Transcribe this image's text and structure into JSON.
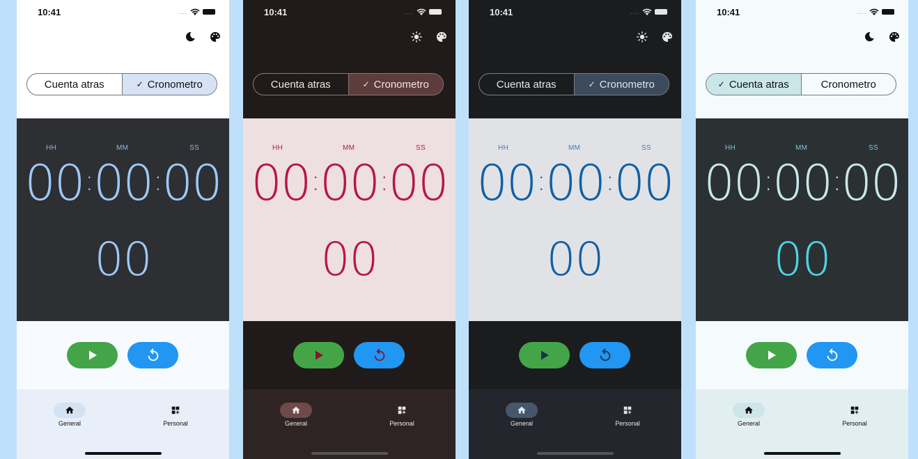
{
  "status": {
    "time": "10:41",
    "dots": "...."
  },
  "segments": {
    "countdown": "Cuenta atras",
    "stopwatch": "Cronometro",
    "check": "✓"
  },
  "timer": {
    "hh_label": "HH",
    "mm_label": "MM",
    "ss_label": "SS",
    "hours": "00",
    "minutes": "00",
    "seconds": "00",
    "separator": ":",
    "centiseconds": "00"
  },
  "nav": {
    "general": "General",
    "personal": "Personal"
  },
  "icons": {
    "moon": "moon-icon",
    "sun": "sun-icon",
    "palette": "palette-icon",
    "play": "play-icon",
    "reset": "reset-icon",
    "home": "home-icon",
    "grid_add": "grid-add-icon"
  },
  "variants": [
    {
      "theme_toggle_icon": "moon-icon",
      "selected_segment": "Cronometro",
      "colors": {
        "bg": "#ffffff",
        "text": "#111111",
        "panel": "#2d2f33",
        "digit": "#9ec9f7",
        "centis": "#9ec9f7",
        "unit": "#8fb6e6",
        "seg_selected": "#d8e2f5",
        "seg_border": "#6f7580",
        "controls_bg": "#f7fafe",
        "nav_bg": "#e8eff8",
        "pill": "#d3e3f4",
        "play_icon": "#ffffff",
        "reset_icon": "#ffffff",
        "homebar": "#111111"
      }
    },
    {
      "theme_toggle_icon": "sun-icon",
      "selected_segment": "Cronometro",
      "colors": {
        "bg": "#201a1a",
        "text": "#f1e6e5",
        "panel": "#eee0e0",
        "digit": "#b8144f",
        "centis": "#b8144f",
        "unit": "#b8144f",
        "seg_selected": "#5d3c3c",
        "seg_border": "#8c7878",
        "controls_bg": "#201a1a",
        "nav_bg": "#2f2424",
        "pill": "#6e4a4a",
        "play_icon": "#8a1130",
        "reset_icon": "#8a1130",
        "homebar": "#555555"
      }
    },
    {
      "theme_toggle_icon": "sun-icon",
      "selected_segment": "Cronometro",
      "colors": {
        "bg": "#1b1c1e",
        "text": "#e3e5ea",
        "panel": "#e1e2e6",
        "digit": "#0f5fa6",
        "centis": "#0f5fa6",
        "unit": "#3d7fbf",
        "seg_selected": "#3b4a5c",
        "seg_border": "#7a808a",
        "controls_bg": "#1b1c1e",
        "nav_bg": "#23262c",
        "pill": "#46566b",
        "play_icon": "#18344f",
        "reset_icon": "#18344f",
        "homebar": "#555555"
      }
    },
    {
      "theme_toggle_icon": "moon-icon",
      "selected_segment": "Cuenta atras",
      "colors": {
        "bg": "#f5fbfc",
        "text": "#111111",
        "panel": "#2b3032",
        "digit": "#c9e7ea",
        "centis": "#4dd2e6",
        "unit": "#77c9dc",
        "seg_selected": "#cbe6e8",
        "seg_border": "#6f7a7c",
        "controls_bg": "#f5fbfc",
        "nav_bg": "#e2eff0",
        "pill": "#cde6e9",
        "play_icon": "#ffffff",
        "reset_icon": "#ffffff",
        "homebar": "#111111"
      }
    }
  ]
}
